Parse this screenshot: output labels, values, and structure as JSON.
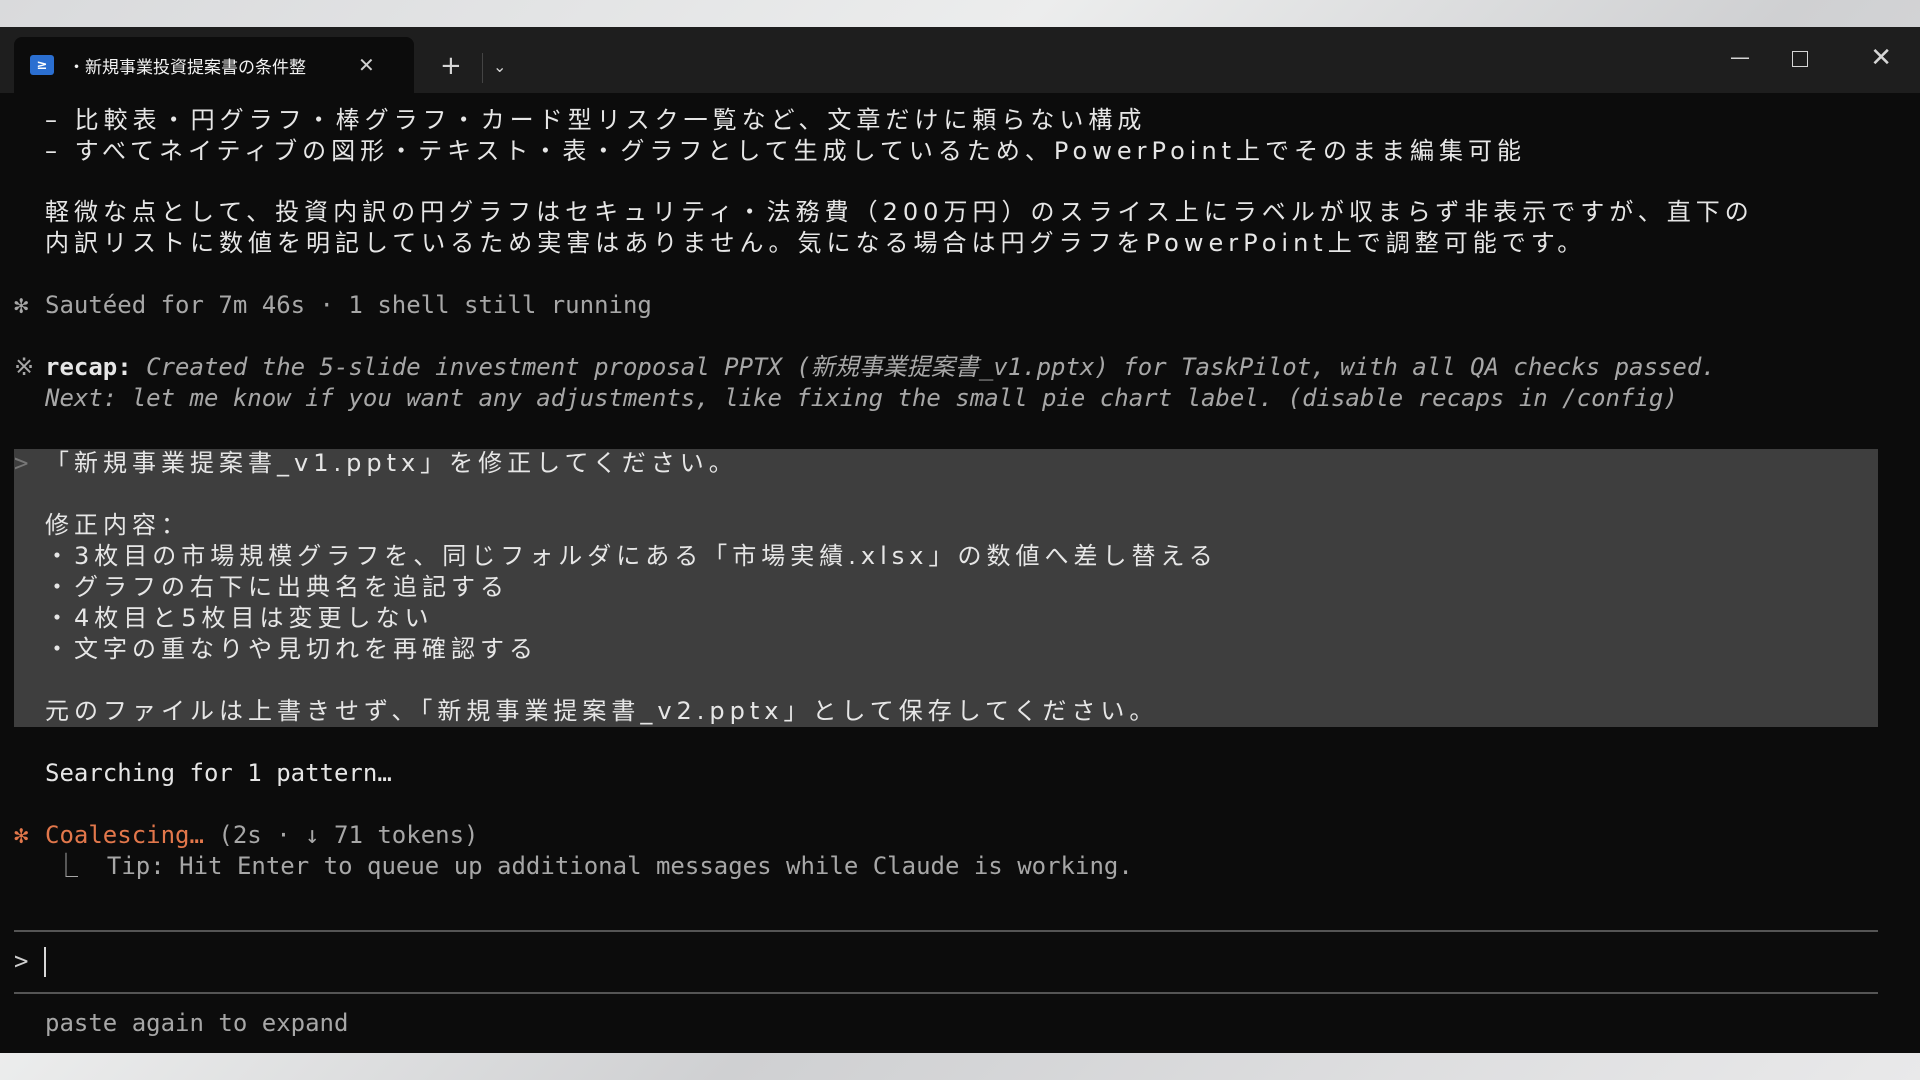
{
  "window": {
    "tab_title": "・新規事業投資提案書の条件整",
    "tab_icon": "terminal-icon",
    "tab_icon_glyph": "≥",
    "close_glyph": "✕",
    "newtab_glyph": "+",
    "dropdown_glyph": "⌄",
    "minimize_glyph": "—",
    "window_close_glyph": "✕"
  },
  "output": {
    "line1": "– 比較表・円グラフ・棒グラフ・カード型リスク一覧など、文章だけに頼らない構成",
    "line2": "– すべてネイティブの図形・テキスト・表・グラフとして生成しているため、PowerPoint上でそのまま編集可能",
    "line3": "軽微な点として、投資内訳の円グラフはセキュリティ・法務費（200万円）のスライス上にラベルが収まらず非表示ですが、直下の",
    "line4": "内訳リストに数値を明記しているため実害はありません。気になる場合は円グラフをPowerPoint上で調整可能です。",
    "status_mark": "✻",
    "status": "Sautéed for 7m 46s · 1 shell still running",
    "recap_mark": "※",
    "recap_label": "recap:",
    "recap_text": " Created the 5-slide investment proposal PPTX (新規事業提案書_v1.pptx) for TaskPilot, with all QA checks passed.",
    "recap_next": "Next: let me know if you want any adjustments, like fixing the small pie chart label. (disable recaps in /config)"
  },
  "user_message": {
    "prompt_mark": ">",
    "lines": [
      "「新規事業提案書_v1.pptx」を修正してください。",
      "修正内容：",
      "・3枚目の市場規模グラフを、同じフォルダにある「市場実績.xlsx」の数値へ差し替える",
      "・グラフの右下に出典名を追記する",
      "・4枚目と5枚目は変更しない",
      "・文字の重なりや見切れを再確認する",
      "元のファイルは上書きせず、「新規事業提案書_v2.pptx」として保存してください。"
    ]
  },
  "activity": {
    "searching": "Searching for 1 pattern…",
    "spinner": "✻",
    "working_label": "Coalescing…",
    "working_meta": " (2s · ↓ 71 tokens)",
    "tip_branch": "⎿",
    "tip": "Tip: Hit Enter to queue up additional messages while Claude is working."
  },
  "input": {
    "prompt": ">",
    "value": ""
  },
  "footer": {
    "hint": "paste again to expand"
  }
}
